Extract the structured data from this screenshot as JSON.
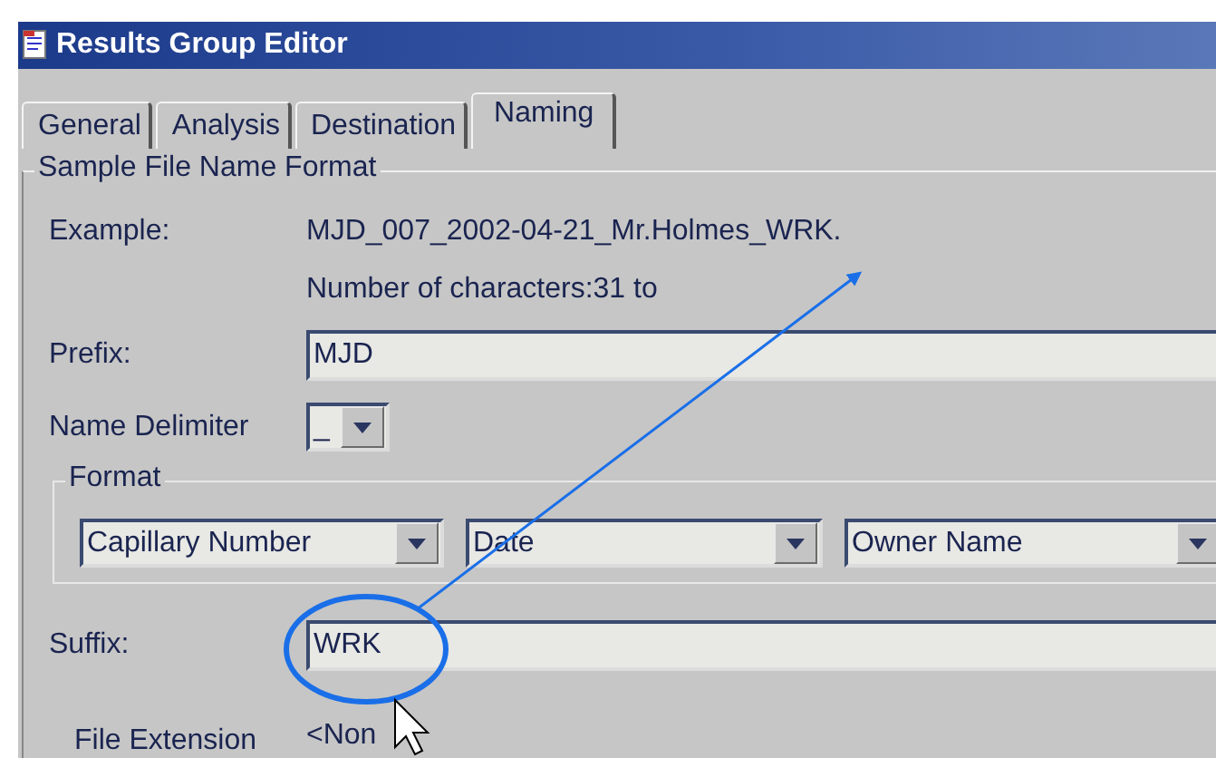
{
  "window": {
    "title": "Results Group Editor"
  },
  "tabs": [
    {
      "label": "General",
      "selected": false
    },
    {
      "label": "Analysis",
      "selected": false
    },
    {
      "label": "Destination",
      "selected": false
    },
    {
      "label": "Naming",
      "selected": true
    }
  ],
  "group": {
    "title": "Sample File Name Format"
  },
  "example": {
    "label": "Example:",
    "value": "MJD_007_2002-04-21_Mr.Holmes_WRK.",
    "char_count": "Number of characters:31 to"
  },
  "prefix": {
    "label": "Prefix:",
    "value": "MJD"
  },
  "name_delimiter": {
    "label": "Name Delimiter",
    "value": "_"
  },
  "format": {
    "title": "Format",
    "fields": [
      "Capillary Number",
      "Date",
      "Owner Name"
    ]
  },
  "suffix": {
    "label": "Suffix:",
    "value": "WRK"
  },
  "file_extension": {
    "label": "File Extension",
    "value": "<Non"
  }
}
